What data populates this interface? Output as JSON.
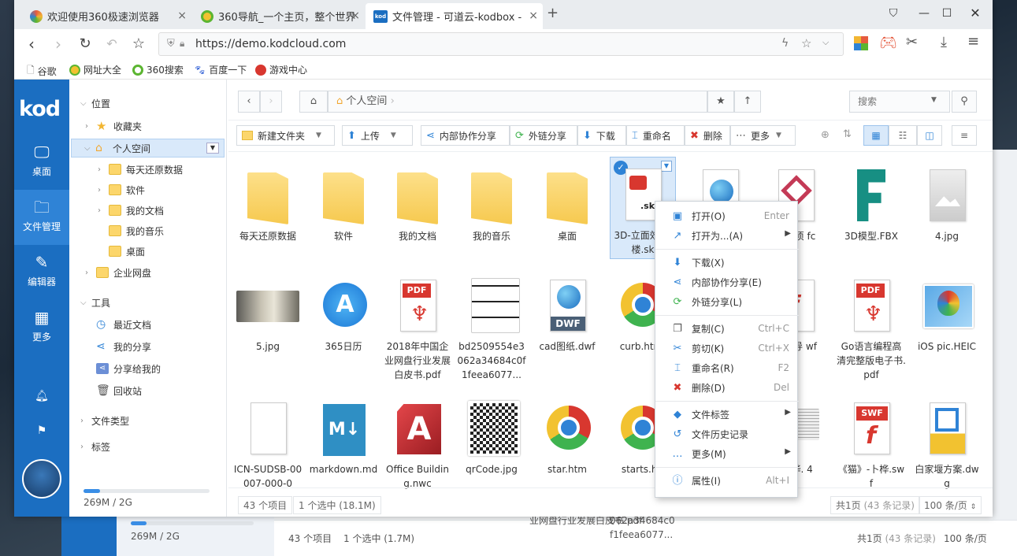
{
  "browser": {
    "tabs": [
      {
        "label": "欢迎使用360极速浏览器",
        "color": "#e65b3f"
      },
      {
        "label": "360导航_一个主页，整个世界",
        "color": "#5bb531"
      },
      {
        "label": "文件管理 - 可道云-kodbox -",
        "color": "#1b6ec1",
        "fav_text": "kod"
      }
    ],
    "url": "https://demo.kodcloud.com",
    "bookmarks": [
      "谷歌",
      "网址大全",
      "360搜索",
      "百度一下",
      "游戏中心"
    ]
  },
  "nav": {
    "logo": "kod",
    "items": [
      "桌面",
      "文件管理",
      "编辑器",
      "更多"
    ]
  },
  "tree": {
    "location_header": "位置",
    "favorites": "收藏夹",
    "personal": "个人空间",
    "children": [
      "每天还原数据",
      "软件",
      "我的文档",
      "我的音乐",
      "桌面"
    ],
    "enterprise": "企业网盘",
    "tools_header": "工具",
    "tools": [
      "最近文档",
      "我的分享",
      "分享给我的",
      "回收站"
    ],
    "filetypes": "文件类型",
    "tags": "标签",
    "quota_text": "269M / 2G",
    "quota_fraction": 0.13
  },
  "pathbar": {
    "crumb": "个人空间",
    "search_placeholder": "搜索"
  },
  "toolbar": {
    "new_folder": "新建文件夹",
    "upload": "上传",
    "internal_share": "内部协作分享",
    "external_share": "外链分享",
    "download": "下载",
    "rename": "重命名",
    "delete": "删除",
    "more": "更多"
  },
  "files": [
    {
      "name": "每天还原数据",
      "kind": "folder"
    },
    {
      "name": "软件",
      "kind": "folder"
    },
    {
      "name": "我的文档",
      "kind": "folder"
    },
    {
      "name": "我的音乐",
      "kind": "folder"
    },
    {
      "name": "桌面",
      "kind": "folder"
    },
    {
      "name": "3D-立面效 大楼.sk",
      "kind": "skp",
      "badge": ".skp"
    },
    {
      "name": "",
      "kind": "globe"
    },
    {
      "name": "苹楼项 fc",
      "kind": "gem"
    },
    {
      "name": "3D模型.FBX",
      "kind": "fbx"
    },
    {
      "name": "4.jpg",
      "kind": "image"
    },
    {
      "name": "5.jpg",
      "kind": "photo"
    },
    {
      "name": "365日历",
      "kind": "appstore"
    },
    {
      "name": "2018年中国企业网盘行业发展白皮书.pdf",
      "kind": "pdf",
      "badge": "PDF"
    },
    {
      "name": "bd2509554e3062a34684c0f1feea6077...",
      "kind": "meme"
    },
    {
      "name": "cad图纸.dwf",
      "kind": "dwf",
      "badge": "DWF"
    },
    {
      "name": "curb.htm",
      "kind": "chrome"
    },
    {
      "name": "思维导 wf",
      "kind": "flash"
    },
    {
      "name": "Go语言编程高清完整版电子书.pdf",
      "kind": "pdf",
      "badge": "PDF"
    },
    {
      "name": "iOS pic.HEIC",
      "kind": "balloon"
    },
    {
      "name": "ICN-SUDSB-00007-000-0",
      "kind": "blank"
    },
    {
      "name": "markdown.md",
      "kind": "md",
      "badge": "M↓"
    },
    {
      "name": "Office Building.nwc",
      "kind": "autocad",
      "badge": "A"
    },
    {
      "name": "qrCode.jpg",
      "kind": "qr"
    },
    {
      "name": "star.htm",
      "kind": "chrome"
    },
    {
      "name": "starts.ht",
      "kind": "chrome"
    },
    {
      "name": "-卜桦. 4",
      "kind": "paper"
    },
    {
      "name": "《猫》-卜桦.swf",
      "kind": "swf",
      "badge": "SWF"
    },
    {
      "name": "白家堰方案.dwg",
      "kind": "dwg"
    }
  ],
  "status": {
    "count": "43 个项目",
    "selected": "1 个选中 (18.1M)",
    "pages": "共1页",
    "pages_detail": "(43 条记录)",
    "per_page": "100 条/页"
  },
  "context_menu": {
    "groups": [
      [
        {
          "label": "打开(O)",
          "shortcut": "Enter",
          "icon": "open-icon",
          "glyph": "▣",
          "color": "#2f83d6"
        },
        {
          "label": "打开为...(A)",
          "submenu": true,
          "icon": "open-with-icon",
          "glyph": "↗",
          "color": "#2f83d6"
        }
      ],
      [
        {
          "label": "下载(X)",
          "icon": "download-icon",
          "glyph": "⬇",
          "color": "#2f83d6"
        },
        {
          "label": "内部协作分享(E)",
          "icon": "share-icon",
          "glyph": "⋖",
          "color": "#2f83d6"
        },
        {
          "label": "外链分享(L)",
          "icon": "link-share-icon",
          "glyph": "⟳",
          "color": "#3fb34f"
        }
      ],
      [
        {
          "label": "复制(C)",
          "shortcut": "Ctrl+C",
          "icon": "copy-icon",
          "glyph": "❐",
          "color": "#555"
        },
        {
          "label": "剪切(K)",
          "shortcut": "Ctrl+X",
          "icon": "cut-icon",
          "glyph": "✂",
          "color": "#2f83d6"
        },
        {
          "label": "重命名(R)",
          "shortcut": "F2",
          "icon": "rename-icon",
          "glyph": "⌶",
          "color": "#2f83d6"
        },
        {
          "label": "删除(D)",
          "shortcut": "Del",
          "icon": "delete-icon",
          "glyph": "✖",
          "color": "#d8372f"
        }
      ],
      [
        {
          "label": "文件标签",
          "submenu": true,
          "icon": "tag-icon",
          "glyph": "◆",
          "color": "#2f83d6"
        },
        {
          "label": "文件历史记录",
          "icon": "history-icon",
          "glyph": "↺",
          "color": "#2f83d6"
        },
        {
          "label": "更多(M)",
          "submenu": true,
          "icon": "more-icon",
          "glyph": "…",
          "color": "#2f83d6"
        }
      ],
      [
        {
          "label": "属性(I)",
          "shortcut": "Alt+I",
          "icon": "info-icon",
          "glyph": "ⓘ",
          "color": "#2f83d6"
        }
      ]
    ]
  },
  "background_window": {
    "quota_text": "269M / 2G",
    "count": "43 个项目",
    "selected": "1 个选中 (1.7M)",
    "file1": "业网盘行业发展白皮书.pdf",
    "file2": "062a34684c0 f1feea6077...",
    "pages": "共1页",
    "pages_detail": "(43 条记录)",
    "per_page": "100 条/页"
  }
}
